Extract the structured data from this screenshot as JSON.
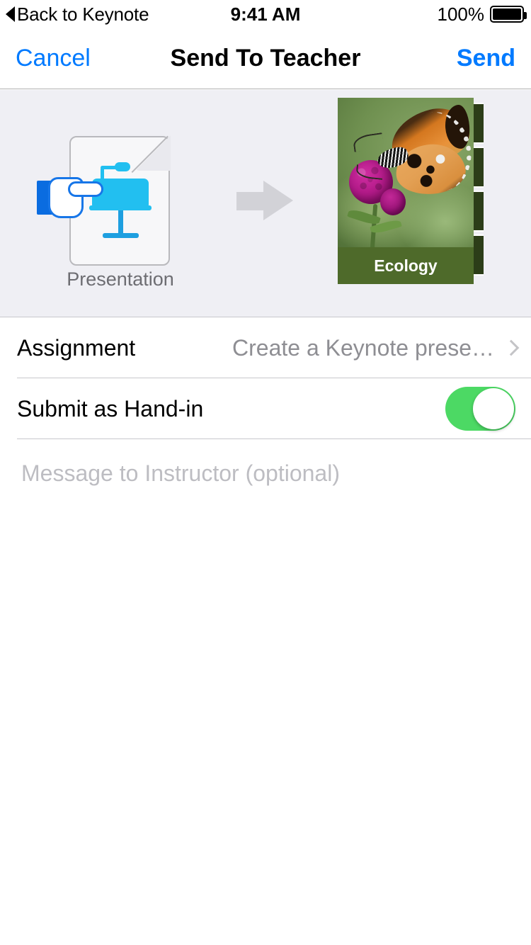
{
  "status_bar": {
    "back_label": "Back to Keynote",
    "back_icon": "triangle-left-icon",
    "time": "9:41 AM",
    "battery_percent": "100%",
    "battery_icon": "battery-full-icon"
  },
  "nav_bar": {
    "cancel_label": "Cancel",
    "title": "Send To Teacher",
    "send_label": "Send",
    "tint_color": "#007AFF"
  },
  "preview": {
    "source": {
      "icon_name": "keynote-document-icon",
      "label": "Presentation"
    },
    "arrow_icon": "arrow-right-icon",
    "destination": {
      "icon_name": "presentation-thumbnail",
      "title": "Ecology",
      "caption_color": "#4E6A2A"
    },
    "background_color": "#EFEFF4"
  },
  "form": {
    "rows": [
      {
        "label": "Assignment",
        "value": "Create a Keynote prese…",
        "accessory": "chevron-right-icon",
        "type": "disclosure"
      },
      {
        "label": "Submit as Hand-in",
        "accessory": "toggle",
        "type": "switch",
        "toggle_on": true,
        "toggle_color": "#4CD964"
      }
    ],
    "message": {
      "placeholder": "Message to Instructor (optional)",
      "value": ""
    }
  }
}
